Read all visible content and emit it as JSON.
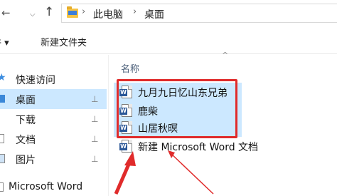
{
  "address_bar": {
    "back_icon": "arrow-left",
    "dropdown_icon": "chevron-down",
    "up_icon": "arrow-up",
    "breadcrumbs": [
      "此电脑",
      "桌面"
    ],
    "separator": "›"
  },
  "toolbar": {
    "partial_item": "件 ▾",
    "new_folder": "新建文件夹"
  },
  "sidebar": {
    "items": [
      {
        "label": "快速访问",
        "pinned": false,
        "selected": false,
        "icon": "star-icon"
      },
      {
        "label": "桌面",
        "pinned": true,
        "selected": true,
        "icon": "desktop-icon"
      },
      {
        "label": "下载",
        "pinned": true,
        "selected": false,
        "icon": "download-icon"
      },
      {
        "label": "文档",
        "pinned": true,
        "selected": false,
        "icon": "document-icon"
      },
      {
        "label": "图片",
        "pinned": true,
        "selected": false,
        "icon": "picture-icon"
      },
      {
        "label": "Microsoft Word",
        "pinned": false,
        "selected": false,
        "icon": "word-icon"
      }
    ],
    "pin_glyph": "📌"
  },
  "main": {
    "column_header": "名称",
    "sort_indicator": "^",
    "files": [
      {
        "name": "九月九日忆山东兄弟",
        "selected": true
      },
      {
        "name": "鹿柴",
        "selected": true
      },
      {
        "name": "山居秋暝",
        "selected": true
      },
      {
        "name": "新建 Microsoft Word 文档",
        "selected": false
      }
    ]
  },
  "colors": {
    "selection": "#cce8ff",
    "annotation": "#e02b2b",
    "word_blue": "#2b5797"
  }
}
